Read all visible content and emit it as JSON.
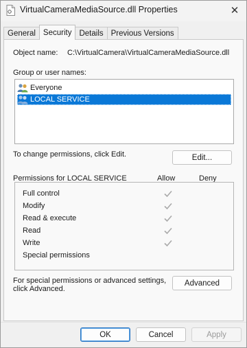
{
  "window": {
    "title": "VirtualCameraMediaSource.dll Properties",
    "close_glyph": "✕"
  },
  "tabs": [
    {
      "label": "General",
      "active": false
    },
    {
      "label": "Security",
      "active": true
    },
    {
      "label": "Details",
      "active": false
    },
    {
      "label": "Previous Versions",
      "active": false
    }
  ],
  "security": {
    "object_name_label": "Object name:",
    "object_name_value": "C:\\VirtualCamera\\VirtualCameraMediaSource.dll",
    "group_label": "Group or user names:",
    "users": [
      {
        "name": "Everyone",
        "icon": "users-icon",
        "selected": false
      },
      {
        "name": "LOCAL SERVICE",
        "icon": "users-icon",
        "selected": true
      }
    ],
    "change_hint": "To change permissions, click Edit.",
    "edit_button": "Edit...",
    "permissions_for": "Permissions for LOCAL SERVICE",
    "allow_header": "Allow",
    "deny_header": "Deny",
    "permissions": [
      {
        "name": "Full control",
        "allow": true,
        "deny": false
      },
      {
        "name": "Modify",
        "allow": true,
        "deny": false
      },
      {
        "name": "Read & execute",
        "allow": true,
        "deny": false
      },
      {
        "name": "Read",
        "allow": true,
        "deny": false
      },
      {
        "name": "Write",
        "allow": true,
        "deny": false
      },
      {
        "name": "Special permissions",
        "allow": false,
        "deny": false
      }
    ],
    "advanced_hint_line1": "For special permissions or advanced settings,",
    "advanced_hint_line2": "click Advanced.",
    "advanced_button": "Advanced"
  },
  "footer": {
    "ok": "OK",
    "cancel": "Cancel",
    "apply": "Apply"
  },
  "colors": {
    "selection": "#0a78d7",
    "checkmark_disabled": "#a9a9a9"
  }
}
